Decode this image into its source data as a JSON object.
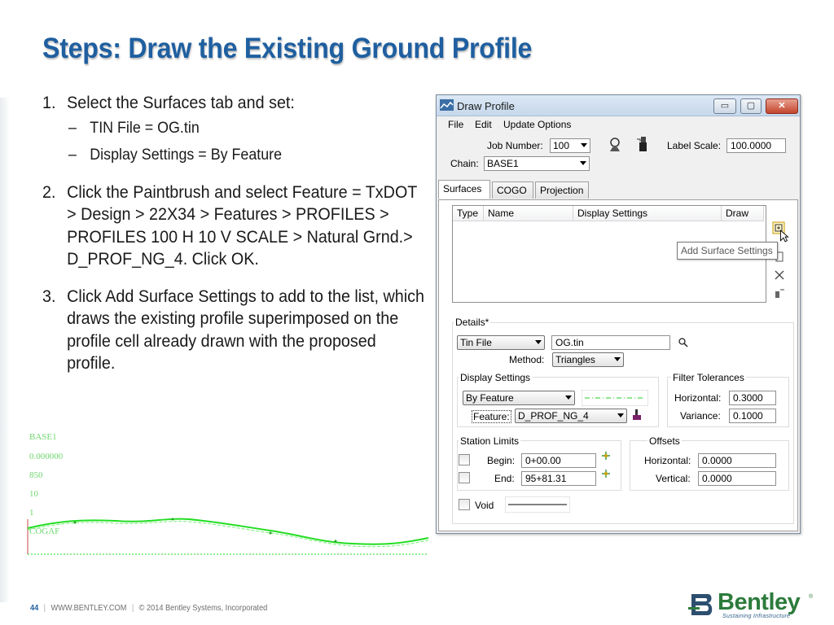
{
  "slide": {
    "title": "Steps:  Draw the Existing Ground Profile",
    "steps": [
      {
        "num": "1.",
        "text": "Select the Surfaces tab and set:"
      },
      {
        "num": "2.",
        "text": "Click the Paintbrush and select Feature = TxDOT > Design > 22X34 > Features > PROFILES > PROFILES 100 H 10 V SCALE > Natural Grnd.> D_PROF_NG_4.  Click OK."
      },
      {
        "num": "3.",
        "text": "Click Add Surface Settings to add to the list, which draws the existing profile superimposed on the profile cell already drawn with the proposed profile."
      }
    ],
    "sub_bullets": [
      {
        "dash": "–",
        "text": "TIN File = OG.tin"
      },
      {
        "dash": "–",
        "text": "Display Settings = By Feature"
      }
    ]
  },
  "profile_plot": {
    "labels": [
      "BASE1",
      "0.000000",
      "850",
      "10",
      "1",
      "COGAF"
    ]
  },
  "window": {
    "title": "Draw Profile",
    "buttons": {
      "min": "▭",
      "max": "▢",
      "close": "✕"
    },
    "menu": [
      "File",
      "Edit",
      "Update Options"
    ],
    "job_number_label": "Job Number:",
    "job_number_value": "100",
    "label_scale_label": "Label Scale:",
    "label_scale_value": "100.0000",
    "chain_label": "Chain:",
    "chain_value": "BASE1",
    "tabs": [
      "Surfaces",
      "COGO",
      "Projection"
    ],
    "list_headers": [
      "Type",
      "Name",
      "Display Settings",
      "Draw"
    ],
    "tooltip": "Add Surface Settings",
    "details_label": "Details*",
    "source_type": "Tin File",
    "tin_name": "OG.tin",
    "method_label": "Method:",
    "method_value": "Triangles",
    "display_settings_label": "Display Settings",
    "display_mode": "By Feature",
    "feature_label": "Feature:",
    "feature_value": "D_PROF_NG_4",
    "filter_tolerances_label": "Filter Tolerances",
    "horizontal_label": "Horizontal:",
    "horizontal_value": "0.3000",
    "variance_label": "Variance:",
    "variance_value": "0.1000",
    "station_limits_label": "Station Limits",
    "begin_label": "Begin:",
    "begin_value": "0+00.00",
    "end_label": "End:",
    "end_value": "95+81.31",
    "offsets_label": "Offsets",
    "offset_h_label": "Horizontal:",
    "offset_h_value": "0.0000",
    "offset_v_label": "Vertical:",
    "offset_v_value": "0.0000",
    "void_label": "Void"
  },
  "footer": {
    "page": "44",
    "site": "WWW.BENTLEY.COM",
    "copyright": "© 2014 Bentley Systems, Incorporated"
  },
  "logo": {
    "name": "Bentley",
    "reg": "®",
    "tagline": "Sustaining Infrastructure"
  },
  "colors": {
    "title_blue": "#1f5fa0",
    "profile_green": "#22dd22",
    "bentley_green": "#2d7b3c"
  }
}
